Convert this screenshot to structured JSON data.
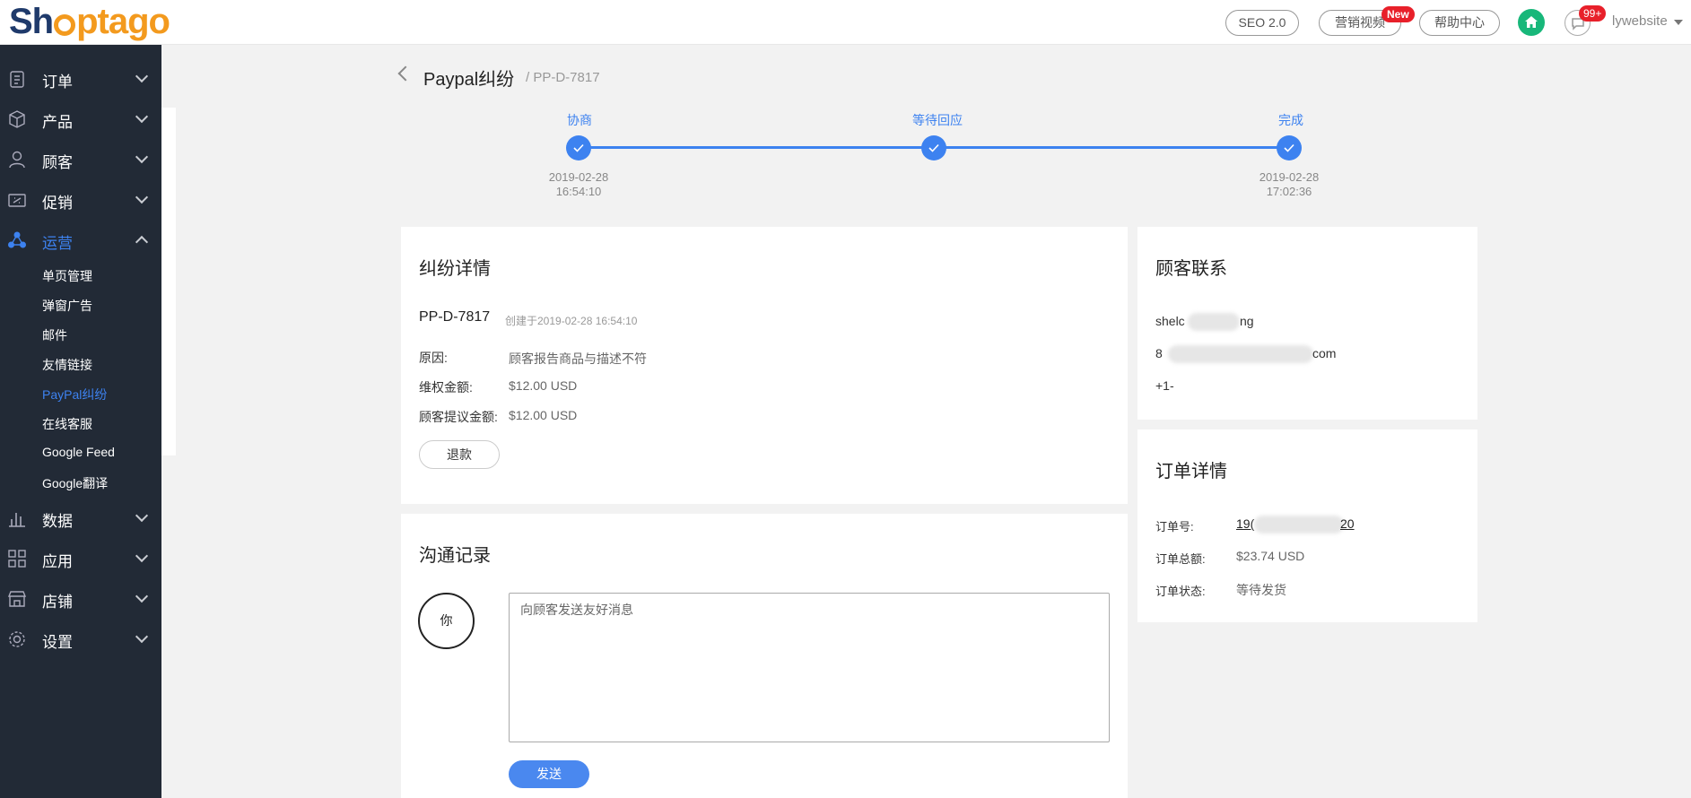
{
  "brand": {
    "part1": "Sh",
    "part2": "ptago"
  },
  "topbar": {
    "seo_label": "SEO 2.0",
    "video_label": "营销视频",
    "new_badge": "New",
    "help_label": "帮助中心",
    "msg_count": "99+",
    "username": "lywebsite"
  },
  "sidebar": {
    "items": [
      {
        "label": "订单",
        "icon": "clipboard-icon"
      },
      {
        "label": "产品",
        "icon": "box-icon"
      },
      {
        "label": "顾客",
        "icon": "user-icon"
      },
      {
        "label": "促销",
        "icon": "ticket-icon"
      },
      {
        "label": "运营",
        "icon": "share-icon"
      },
      {
        "label": "数据",
        "icon": "bar-chart-icon"
      },
      {
        "label": "应用",
        "icon": "apps-icon"
      },
      {
        "label": "店铺",
        "icon": "store-icon"
      },
      {
        "label": "设置",
        "icon": "gear-icon"
      }
    ],
    "subitems": [
      "单页管理",
      "弹窗广告",
      "邮件",
      "友情链接",
      "PayPal纠纷",
      "在线客服",
      "Google Feed",
      "Google翻译"
    ]
  },
  "page": {
    "title": "Paypal纠纷",
    "crumb": "/ PP-D-7817"
  },
  "steps": [
    {
      "label": "协商",
      "date": "2019-02-28",
      "time": "16:54:10"
    },
    {
      "label": "等待回应",
      "date": "",
      "time": ""
    },
    {
      "label": "完成",
      "date": "2019-02-28",
      "time": "17:02:36"
    }
  ],
  "dispute": {
    "title": "纠纷详情",
    "id": "PP-D-7817",
    "created": "创建于2019-02-28 16:54:10",
    "reason_label": "原因:",
    "reason_value": "顾客报告商品与描述不符",
    "amount_label": "维权金额:",
    "amount_value": "$12.00 USD",
    "proposed_label": "顾客提议金额:",
    "proposed_value": "$12.00 USD",
    "refund_button": "退款"
  },
  "communication": {
    "title": "沟通记录",
    "avatar_text": "你",
    "placeholder": "向顾客发送友好消息",
    "send_button": "发送"
  },
  "customer": {
    "title": "顾客联系",
    "name_start": "shelc",
    "name_end": "ng",
    "email_start": "8",
    "email_end": "com",
    "phone": "+1-"
  },
  "order": {
    "title": "订单详情",
    "number_label": "订单号:",
    "number_start": "19(",
    "number_end": "20",
    "total_label": "订单总额:",
    "total_value": "$23.74 USD",
    "status_label": "订单状态:",
    "status_value": "等待发货"
  },
  "colors": {
    "accent": "#3d82f0",
    "sidebar_bg": "#222a36",
    "home": "#18b77a",
    "badge": "#e8202a"
  }
}
